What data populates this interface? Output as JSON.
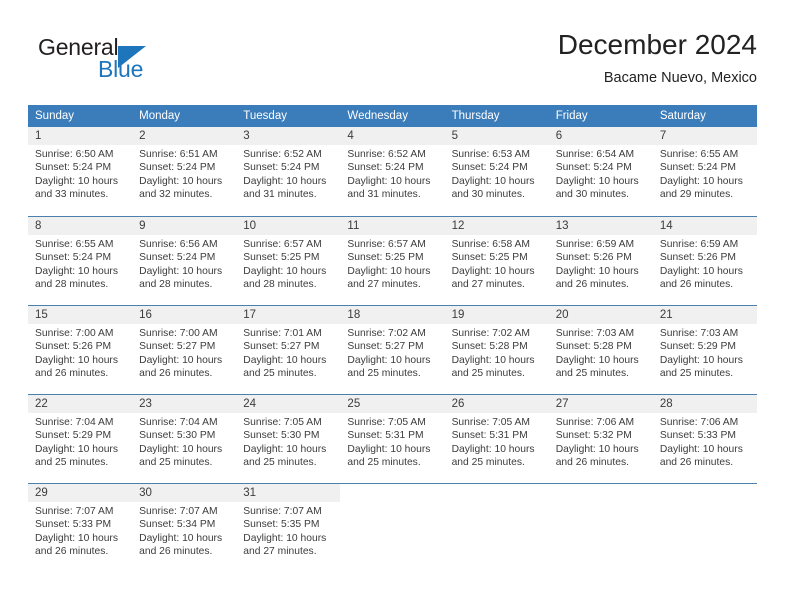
{
  "brand": {
    "name_top": "General",
    "name_bottom": "Blue",
    "color_dark": "#231f20",
    "color_blue": "#1d76bc"
  },
  "header": {
    "title": "December 2024",
    "subtitle": "Bacame Nuevo, Mexico"
  },
  "theme": {
    "header_bg": "#3b7cba",
    "header_text": "#ffffff",
    "day_number_bg": "#f0f0f0",
    "body_text": "#3c3c3c"
  },
  "weekdays": [
    "Sunday",
    "Monday",
    "Tuesday",
    "Wednesday",
    "Thursday",
    "Friday",
    "Saturday"
  ],
  "weeks": [
    [
      {
        "day": "1",
        "sunrise": "Sunrise: 6:50 AM",
        "sunset": "Sunset: 5:24 PM",
        "daylight1": "Daylight: 10 hours",
        "daylight2": "and 33 minutes."
      },
      {
        "day": "2",
        "sunrise": "Sunrise: 6:51 AM",
        "sunset": "Sunset: 5:24 PM",
        "daylight1": "Daylight: 10 hours",
        "daylight2": "and 32 minutes."
      },
      {
        "day": "3",
        "sunrise": "Sunrise: 6:52 AM",
        "sunset": "Sunset: 5:24 PM",
        "daylight1": "Daylight: 10 hours",
        "daylight2": "and 31 minutes."
      },
      {
        "day": "4",
        "sunrise": "Sunrise: 6:52 AM",
        "sunset": "Sunset: 5:24 PM",
        "daylight1": "Daylight: 10 hours",
        "daylight2": "and 31 minutes."
      },
      {
        "day": "5",
        "sunrise": "Sunrise: 6:53 AM",
        "sunset": "Sunset: 5:24 PM",
        "daylight1": "Daylight: 10 hours",
        "daylight2": "and 30 minutes."
      },
      {
        "day": "6",
        "sunrise": "Sunrise: 6:54 AM",
        "sunset": "Sunset: 5:24 PM",
        "daylight1": "Daylight: 10 hours",
        "daylight2": "and 30 minutes."
      },
      {
        "day": "7",
        "sunrise": "Sunrise: 6:55 AM",
        "sunset": "Sunset: 5:24 PM",
        "daylight1": "Daylight: 10 hours",
        "daylight2": "and 29 minutes."
      }
    ],
    [
      {
        "day": "8",
        "sunrise": "Sunrise: 6:55 AM",
        "sunset": "Sunset: 5:24 PM",
        "daylight1": "Daylight: 10 hours",
        "daylight2": "and 28 minutes."
      },
      {
        "day": "9",
        "sunrise": "Sunrise: 6:56 AM",
        "sunset": "Sunset: 5:24 PM",
        "daylight1": "Daylight: 10 hours",
        "daylight2": "and 28 minutes."
      },
      {
        "day": "10",
        "sunrise": "Sunrise: 6:57 AM",
        "sunset": "Sunset: 5:25 PM",
        "daylight1": "Daylight: 10 hours",
        "daylight2": "and 28 minutes."
      },
      {
        "day": "11",
        "sunrise": "Sunrise: 6:57 AM",
        "sunset": "Sunset: 5:25 PM",
        "daylight1": "Daylight: 10 hours",
        "daylight2": "and 27 minutes."
      },
      {
        "day": "12",
        "sunrise": "Sunrise: 6:58 AM",
        "sunset": "Sunset: 5:25 PM",
        "daylight1": "Daylight: 10 hours",
        "daylight2": "and 27 minutes."
      },
      {
        "day": "13",
        "sunrise": "Sunrise: 6:59 AM",
        "sunset": "Sunset: 5:26 PM",
        "daylight1": "Daylight: 10 hours",
        "daylight2": "and 26 minutes."
      },
      {
        "day": "14",
        "sunrise": "Sunrise: 6:59 AM",
        "sunset": "Sunset: 5:26 PM",
        "daylight1": "Daylight: 10 hours",
        "daylight2": "and 26 minutes."
      }
    ],
    [
      {
        "day": "15",
        "sunrise": "Sunrise: 7:00 AM",
        "sunset": "Sunset: 5:26 PM",
        "daylight1": "Daylight: 10 hours",
        "daylight2": "and 26 minutes."
      },
      {
        "day": "16",
        "sunrise": "Sunrise: 7:00 AM",
        "sunset": "Sunset: 5:27 PM",
        "daylight1": "Daylight: 10 hours",
        "daylight2": "and 26 minutes."
      },
      {
        "day": "17",
        "sunrise": "Sunrise: 7:01 AM",
        "sunset": "Sunset: 5:27 PM",
        "daylight1": "Daylight: 10 hours",
        "daylight2": "and 25 minutes."
      },
      {
        "day": "18",
        "sunrise": "Sunrise: 7:02 AM",
        "sunset": "Sunset: 5:27 PM",
        "daylight1": "Daylight: 10 hours",
        "daylight2": "and 25 minutes."
      },
      {
        "day": "19",
        "sunrise": "Sunrise: 7:02 AM",
        "sunset": "Sunset: 5:28 PM",
        "daylight1": "Daylight: 10 hours",
        "daylight2": "and 25 minutes."
      },
      {
        "day": "20",
        "sunrise": "Sunrise: 7:03 AM",
        "sunset": "Sunset: 5:28 PM",
        "daylight1": "Daylight: 10 hours",
        "daylight2": "and 25 minutes."
      },
      {
        "day": "21",
        "sunrise": "Sunrise: 7:03 AM",
        "sunset": "Sunset: 5:29 PM",
        "daylight1": "Daylight: 10 hours",
        "daylight2": "and 25 minutes."
      }
    ],
    [
      {
        "day": "22",
        "sunrise": "Sunrise: 7:04 AM",
        "sunset": "Sunset: 5:29 PM",
        "daylight1": "Daylight: 10 hours",
        "daylight2": "and 25 minutes."
      },
      {
        "day": "23",
        "sunrise": "Sunrise: 7:04 AM",
        "sunset": "Sunset: 5:30 PM",
        "daylight1": "Daylight: 10 hours",
        "daylight2": "and 25 minutes."
      },
      {
        "day": "24",
        "sunrise": "Sunrise: 7:05 AM",
        "sunset": "Sunset: 5:30 PM",
        "daylight1": "Daylight: 10 hours",
        "daylight2": "and 25 minutes."
      },
      {
        "day": "25",
        "sunrise": "Sunrise: 7:05 AM",
        "sunset": "Sunset: 5:31 PM",
        "daylight1": "Daylight: 10 hours",
        "daylight2": "and 25 minutes."
      },
      {
        "day": "26",
        "sunrise": "Sunrise: 7:05 AM",
        "sunset": "Sunset: 5:31 PM",
        "daylight1": "Daylight: 10 hours",
        "daylight2": "and 25 minutes."
      },
      {
        "day": "27",
        "sunrise": "Sunrise: 7:06 AM",
        "sunset": "Sunset: 5:32 PM",
        "daylight1": "Daylight: 10 hours",
        "daylight2": "and 26 minutes."
      },
      {
        "day": "28",
        "sunrise": "Sunrise: 7:06 AM",
        "sunset": "Sunset: 5:33 PM",
        "daylight1": "Daylight: 10 hours",
        "daylight2": "and 26 minutes."
      }
    ],
    [
      {
        "day": "29",
        "sunrise": "Sunrise: 7:07 AM",
        "sunset": "Sunset: 5:33 PM",
        "daylight1": "Daylight: 10 hours",
        "daylight2": "and 26 minutes."
      },
      {
        "day": "30",
        "sunrise": "Sunrise: 7:07 AM",
        "sunset": "Sunset: 5:34 PM",
        "daylight1": "Daylight: 10 hours",
        "daylight2": "and 26 minutes."
      },
      {
        "day": "31",
        "sunrise": "Sunrise: 7:07 AM",
        "sunset": "Sunset: 5:35 PM",
        "daylight1": "Daylight: 10 hours",
        "daylight2": "and 27 minutes."
      },
      {
        "day": "",
        "sunrise": "",
        "sunset": "",
        "daylight1": "",
        "daylight2": ""
      },
      {
        "day": "",
        "sunrise": "",
        "sunset": "",
        "daylight1": "",
        "daylight2": ""
      },
      {
        "day": "",
        "sunrise": "",
        "sunset": "",
        "daylight1": "",
        "daylight2": ""
      },
      {
        "day": "",
        "sunrise": "",
        "sunset": "",
        "daylight1": "",
        "daylight2": ""
      }
    ]
  ]
}
